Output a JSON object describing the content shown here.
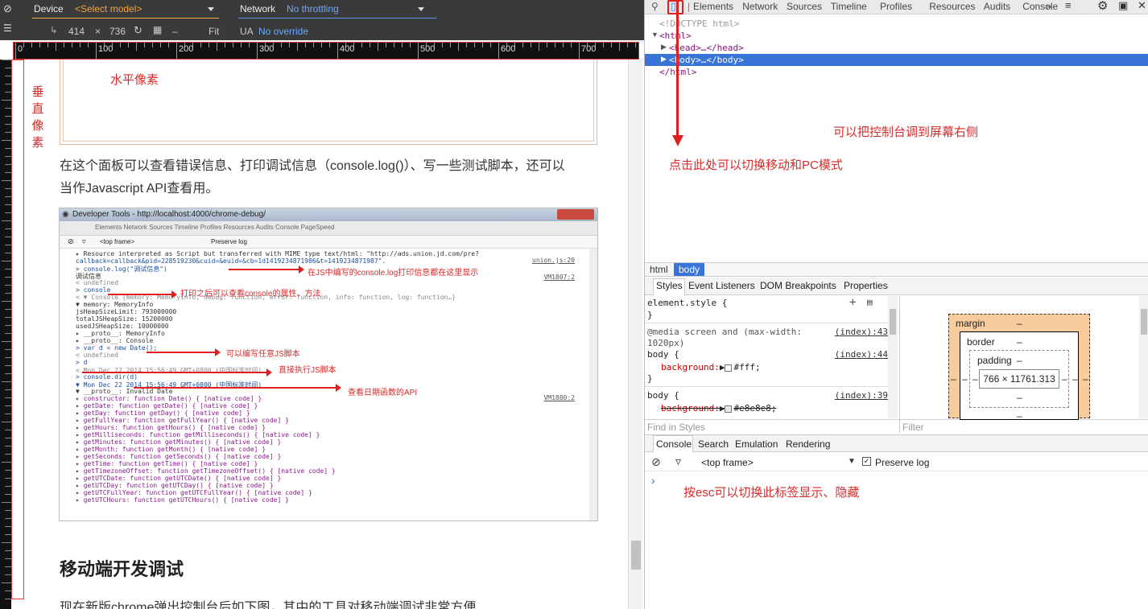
{
  "emulation": {
    "device_label": "Device",
    "device_value": "<Select model>",
    "network_label": "Network",
    "network_value": "No throttling",
    "width": "414",
    "times": "×",
    "height": "736",
    "dash": "–",
    "fit": "Fit",
    "ua_label": "UA",
    "ua_value": "No override"
  },
  "ruler": {
    "ticks": [
      "0",
      "100",
      "200",
      "300",
      "400",
      "500",
      "600",
      "700"
    ]
  },
  "annotations": {
    "horizontal_pixels": "水平像素",
    "vertical_pixels": [
      "垂",
      "直",
      "像",
      "素"
    ],
    "dock_right": "可以把控制台调到屏幕右侧",
    "toggle_mode": "点击此处可以切换移动和PC模式",
    "esc_toggle": "按esc可以切换此标签显示、隐藏"
  },
  "article": {
    "para1_line1": "在这个面板可以查看错误信息、打印调试信息（console.log()）、写一些测试脚本，还可以",
    "para1_line2": "当作Javascript API查看用。",
    "heading": "移动端开发调试",
    "para2": "现在新版chrome弹出控制台后如下图，其中的工具对移动端调试非常方便"
  },
  "inner_shot": {
    "window_title": "Developer Tools - http://localhost:4000/chrome-debug/",
    "tabs": "Elements  Network  Sources  Timeline  Profiles  Resources  Audits  Console  PageSpeed",
    "frame": "<top frame>",
    "preserve": "Preserve log",
    "lines": [
      "▸ Resource interpreted as Script but transferred with MIME type text/html: \"http://ads.union.jd.com/pre?",
      "callback=callback&pid=228519230&cuid=&euid=&cb=1d1419234871986&t=1419234871987\".",
      "> console.log(\"调试信息\")",
      "调试信息",
      "< undefined",
      "> console",
      "< ▼ Console {memory: MemoryInfo, debug: function, error: function, info: function, log: function…}",
      "   ▼ memory: MemoryInfo",
      "       jsHeapSizeLimit: 793000000",
      "       totalJSHeapSize: 15200000",
      "       usedJSHeapSize: 10000000",
      "     ▸ __proto__: MemoryInfo",
      "   ▸ __proto__: Console",
      "> var d = new Date();",
      "< undefined",
      "> d",
      "< Mon Dec 22 2014 15:56:49 GMT+0800 (中国标准时间)",
      "> console.dir(d)",
      "  ▼ Mon Dec 22 2014 15:56:49 GMT+0800 (中国标准时间)",
      "    ▼ __proto__: Invalid Date",
      "      ▸ constructor: function Date() { [native code] }",
      "      ▸ getDate: function getDate() { [native code] }",
      "      ▸ getDay: function getDay() { [native code] }",
      "      ▸ getFullYear: function getFullYear() { [native code] }",
      "      ▸ getHours: function getHours() { [native code] }",
      "      ▸ getMilliseconds: function getMilliseconds() { [native code] }",
      "      ▸ getMinutes: function getMinutes() { [native code] }",
      "      ▸ getMonth: function getMonth() { [native code] }",
      "      ▸ getSeconds: function getSeconds() { [native code] }",
      "      ▸ getTime: function getTime() { [native code] }",
      "      ▸ getTimezoneOffset: function getTimezoneOffset() { [native code] }",
      "      ▸ getUTCDate: function getUTCDate() { [native code] }",
      "      ▸ getUTCDay: function getUTCDay() { [native code] }",
      "      ▸ getUTCFullYear: function getUTCFullYear() { [native code] }",
      "      ▸ getUTCHours: function getUTCHours() { [native code] }"
    ],
    "refs": {
      "union": "union.js:20",
      "vm1807": "VM1807:2",
      "vm1880": "VM1880:2"
    },
    "notes": {
      "log": "在JS中编写的console.log打印信息都在这里显示",
      "props": "打印之后可以查看console的属性、方法",
      "script": "可以编写任意JS脚本",
      "exec": "直接执行JS脚本",
      "date": "查看日期函数的API"
    }
  },
  "devtools": {
    "tabs": [
      "Elements",
      "Network",
      "Sources",
      "Timeline",
      "Profiles",
      "Resources",
      "Audits",
      "Console"
    ],
    "more": "»",
    "dom": [
      "<!DOCTYPE html>",
      "<html>",
      "<head>…</head>",
      "<body>…</body>",
      "</html>"
    ],
    "crumbs": [
      "html",
      "body"
    ],
    "style_tabs": [
      "Styles",
      "Event Listeners",
      "DOM Breakpoints",
      "Properties"
    ],
    "styles": {
      "element_style": "element.style {",
      "close": "}",
      "media": "@media screen and (max-width:",
      "media2": "1020px)",
      "src1": "(index):43",
      "body1": "body {",
      "prop1": "background:",
      "val1": "#fff;",
      "src2": "(index):44",
      "body2": "body {",
      "src3": "(index):39",
      "prop2": "background:",
      "val2": "#e8e8e8;",
      "find": "Find in Styles",
      "filter": "Filter"
    },
    "box_model": {
      "margin": "margin",
      "border": "border",
      "padding": "padding",
      "content": "766 × 11761.313",
      "dash": "–"
    },
    "drawer_tabs": [
      "Console",
      "Search",
      "Emulation",
      "Rendering"
    ],
    "console": {
      "frame": "<top frame>",
      "preserve": "Preserve log",
      "prompt": "›"
    }
  }
}
